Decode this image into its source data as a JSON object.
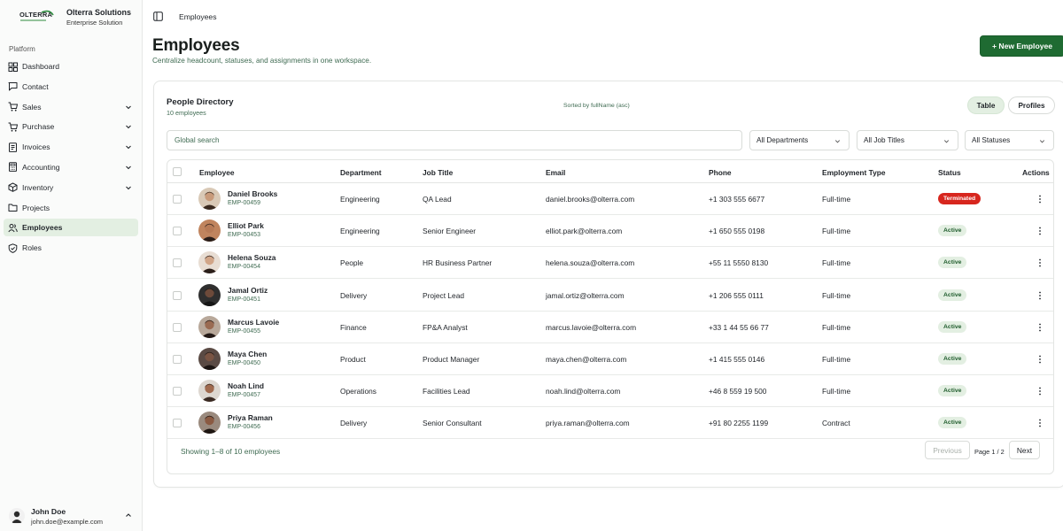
{
  "brand": {
    "logo_text": "OLTERRA",
    "name": "Olterra Solutions",
    "subtitle": "Enterprise Solution"
  },
  "sidebar": {
    "section_label": "Platform",
    "items": [
      {
        "label": "Dashboard",
        "icon": "grid-icon",
        "has_chevron": false,
        "active": false
      },
      {
        "label": "Contact",
        "icon": "message-square-icon",
        "has_chevron": false,
        "active": false
      },
      {
        "label": "Sales",
        "icon": "cart-icon",
        "has_chevron": true,
        "active": false
      },
      {
        "label": "Purchase",
        "icon": "shopping-cart-icon",
        "has_chevron": true,
        "active": false
      },
      {
        "label": "Invoices",
        "icon": "invoice-icon",
        "has_chevron": true,
        "active": false
      },
      {
        "label": "Accounting",
        "icon": "calculator-icon",
        "has_chevron": true,
        "active": false
      },
      {
        "label": "Inventory",
        "icon": "boxes-icon",
        "has_chevron": true,
        "active": false
      },
      {
        "label": "Projects",
        "icon": "folder-icon",
        "has_chevron": false,
        "active": false
      },
      {
        "label": "Employees",
        "icon": "users-icon",
        "has_chevron": false,
        "active": true
      },
      {
        "label": "Roles",
        "icon": "shield-check-icon",
        "has_chevron": false,
        "active": false
      }
    ]
  },
  "user": {
    "name": "John Doe",
    "email": "john.doe@example.com"
  },
  "topbar": {
    "breadcrumb": "Employees"
  },
  "header": {
    "title": "Employees",
    "subtitle": "Centralize headcount, statuses, and assignments in one workspace.",
    "new_button": "+ New Employee"
  },
  "directory": {
    "title": "People Directory",
    "count": "10 employees",
    "sorted": "Sorted by fullName (asc)",
    "view_table": "Table",
    "view_profiles": "Profiles"
  },
  "filters": {
    "search_placeholder": "Global search",
    "department": "All Departments",
    "job_title": "All Job Titles",
    "status": "All Statuses"
  },
  "table": {
    "columns": [
      "Employee",
      "Department",
      "Job Title",
      "Email",
      "Phone",
      "Employment Type",
      "Status",
      "Actions"
    ],
    "rows": [
      {
        "name": "Daniel Brooks",
        "id": "EMP-00459",
        "department": "Engineering",
        "job": "QA Lead",
        "email": "daniel.brooks@olterra.com",
        "phone": "+1 303 555 6677",
        "type": "Full-time",
        "status": "Terminated"
      },
      {
        "name": "Elliot Park",
        "id": "EMP-00453",
        "department": "Engineering",
        "job": "Senior Engineer",
        "email": "elliot.park@olterra.com",
        "phone": "+1 650 555 0198",
        "type": "Full-time",
        "status": "Active"
      },
      {
        "name": "Helena Souza",
        "id": "EMP-00454",
        "department": "People",
        "job": "HR Business Partner",
        "email": "helena.souza@olterra.com",
        "phone": "+55 11 5550 8130",
        "type": "Full-time",
        "status": "Active"
      },
      {
        "name": "Jamal Ortiz",
        "id": "EMP-00451",
        "department": "Delivery",
        "job": "Project Lead",
        "email": "jamal.ortiz@olterra.com",
        "phone": "+1 206 555 0111",
        "type": "Full-time",
        "status": "Active"
      },
      {
        "name": "Marcus Lavoie",
        "id": "EMP-00455",
        "department": "Finance",
        "job": "FP&A Analyst",
        "email": "marcus.lavoie@olterra.com",
        "phone": "+33 1 44 55 66 77",
        "type": "Full-time",
        "status": "Active"
      },
      {
        "name": "Maya Chen",
        "id": "EMP-00450",
        "department": "Product",
        "job": "Product Manager",
        "email": "maya.chen@olterra.com",
        "phone": "+1 415 555 0146",
        "type": "Full-time",
        "status": "Active"
      },
      {
        "name": "Noah Lind",
        "id": "EMP-00457",
        "department": "Operations",
        "job": "Facilities Lead",
        "email": "noah.lind@olterra.com",
        "phone": "+46 8 559 19 500",
        "type": "Full-time",
        "status": "Active"
      },
      {
        "name": "Priya Raman",
        "id": "EMP-00456",
        "department": "Delivery",
        "job": "Senior Consultant",
        "email": "priya.raman@olterra.com",
        "phone": "+91 80 2255 1199",
        "type": "Contract",
        "status": "Active"
      }
    ]
  },
  "pagination": {
    "showing": "Showing 1–8 of 10 employees",
    "previous": "Previous",
    "page": "Page 1 / 2",
    "next": "Next"
  },
  "colors": {
    "accent": "#1f6b32",
    "active_nav_bg": "#e3efe2",
    "terminated": "#d7261e",
    "muted_green_text": "#3f6b52"
  }
}
